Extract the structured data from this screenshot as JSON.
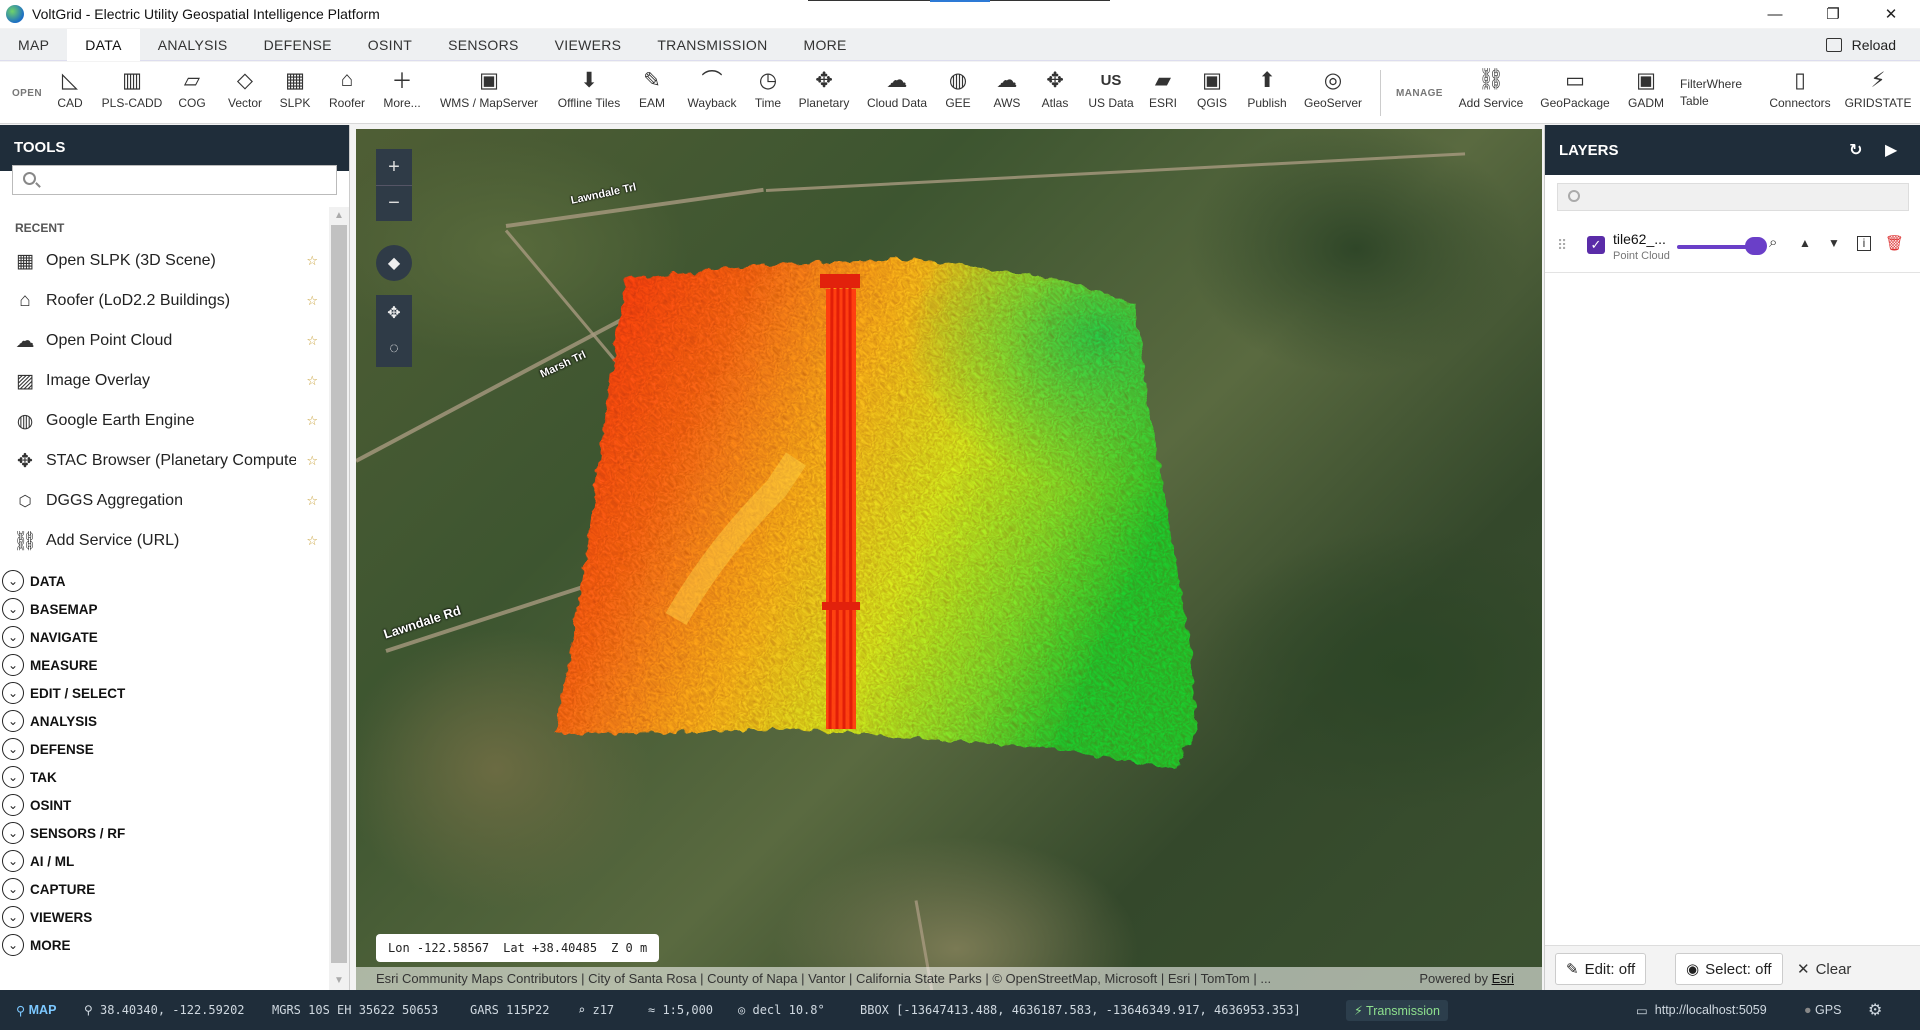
{
  "window": {
    "title": "VoltGrid - Electric Utility Geospatial Intelligence Platform",
    "controls": [
      "—",
      "❐",
      "✕"
    ]
  },
  "menu": {
    "items": [
      "MAP",
      "DATA",
      "ANALYSIS",
      "DEFENSE",
      "OSINT",
      "SENSORS",
      "VIEWERS",
      "TRANSMISSION",
      "MORE"
    ],
    "active": "DATA",
    "reload": "Reload"
  },
  "ribbon": {
    "open_label": "OPEN",
    "manage_label": "MANAGE",
    "open_buttons": [
      {
        "label": "CAD",
        "icon": "cad-icon"
      },
      {
        "label": "PLS-CADD",
        "icon": "pls-cadd-icon"
      },
      {
        "label": "COG",
        "icon": "cog-icon"
      },
      {
        "label": "Vector",
        "icon": "vector-icon"
      },
      {
        "label": "SLPK",
        "icon": "slpk-icon"
      },
      {
        "label": "Roofer",
        "icon": "roofer-icon"
      },
      {
        "label": "More...",
        "icon": "plus-icon"
      },
      {
        "label": "WMS / MapServer",
        "icon": "wms-icon"
      },
      {
        "label": "Offline Tiles",
        "icon": "offline-tiles-icon"
      },
      {
        "label": "EAM",
        "icon": "eam-icon"
      },
      {
        "label": "Wayback",
        "icon": "wayback-icon"
      },
      {
        "label": "Time",
        "icon": "time-icon"
      },
      {
        "label": "Planetary",
        "icon": "planetary-icon"
      },
      {
        "label": "Cloud Data",
        "icon": "cloud-data-icon"
      },
      {
        "label": "GEE",
        "icon": "gee-icon"
      },
      {
        "label": "AWS",
        "icon": "aws-icon"
      },
      {
        "label": "Atlas",
        "icon": "atlas-icon"
      },
      {
        "label": "US Data",
        "icon": "us-data-icon"
      },
      {
        "label": "ESRI",
        "icon": "esri-icon"
      },
      {
        "label": "QGIS",
        "icon": "qgis-icon"
      },
      {
        "label": "Publish",
        "icon": "publish-icon"
      },
      {
        "label": "GeoServer",
        "icon": "geoserver-icon"
      }
    ],
    "manage_buttons": [
      {
        "label": "Add Service",
        "icon": "add-service-icon"
      },
      {
        "label": "GeoPackage",
        "icon": "geopackage-icon"
      },
      {
        "label": "GADM",
        "icon": "gadm-icon"
      },
      {
        "label": "Connectors",
        "icon": "connectors-icon"
      },
      {
        "label": "GRIDSTATE",
        "icon": "gridstate-icon"
      }
    ],
    "filterwhere": {
      "line1": "FilterWhere",
      "line2": "Table"
    },
    "us_glyph": "US"
  },
  "tools": {
    "title": "TOOLS",
    "search_placeholder": "",
    "recent_label": "RECENT",
    "recent": [
      {
        "label": "Open SLPK (3D Scene)",
        "icon": "building-grid-icon"
      },
      {
        "label": "Roofer (LoD2.2 Buildings)",
        "icon": "house-icon"
      },
      {
        "label": "Open Point Cloud",
        "icon": "cloud-icon"
      },
      {
        "label": "Image Overlay",
        "icon": "image-overlay-icon"
      },
      {
        "label": "Google Earth Engine",
        "icon": "globe-icon"
      },
      {
        "label": "STAC Browser (Planetary Computer)",
        "icon": "satellite-icon"
      },
      {
        "label": "DGGS Aggregation",
        "icon": "hexagon-icon"
      },
      {
        "label": "Add Service (URL)",
        "icon": "link-icon"
      }
    ],
    "sections": [
      "DATA",
      "BASEMAP",
      "NAVIGATE",
      "MEASURE",
      "EDIT / SELECT",
      "ANALYSIS",
      "DEFENSE",
      "TAK",
      "OSINT",
      "SENSORS / RF",
      "AI / ML",
      "CAPTURE",
      "VIEWERS",
      "MORE"
    ]
  },
  "map": {
    "road_labels": [
      "Lawndale Trl",
      "Marsh Trl",
      "Lawndale Rd"
    ],
    "coord_readout": {
      "lon": "Lon -122.58567",
      "lat": "Lat +38.40485",
      "z": "Z 0 m"
    },
    "attribution": "Esri Community Maps Contributors | City of Santa Rosa | County of Napa | Vantor | California State Parks | © OpenStreetMap, Microsoft | Esri | TomTom | ...",
    "powered_by": "Powered by",
    "powered_by_link": "Esri"
  },
  "layers": {
    "title": "LAYERS",
    "search_placeholder": "",
    "items": [
      {
        "name": "tile62_...",
        "type": "Point Cloud",
        "visible": true,
        "opacity": 1.0
      }
    ],
    "edit_label": "Edit: off",
    "select_label": "Select: off",
    "clear_label": "Clear"
  },
  "status": {
    "mode": "MAP",
    "latlon": "38.40340, -122.59202",
    "mgrs": "MGRS 10S EH 35622 50653",
    "gars": "GARS 115P22",
    "zoom": "z17",
    "scale": "≈ 1:5,000",
    "decl": "decl 10.8°",
    "bbox": "BBOX [-13647413.488, 4636187.583, -13646349.917, 4636953.353]",
    "transmission": "Transmission",
    "server": "http://localhost:5059",
    "gps": "GPS"
  },
  "colors": {
    "panel_header": "#1f2d3a",
    "accent_purple": "#5a2ca8",
    "status_bg": "#1f2d3a"
  }
}
